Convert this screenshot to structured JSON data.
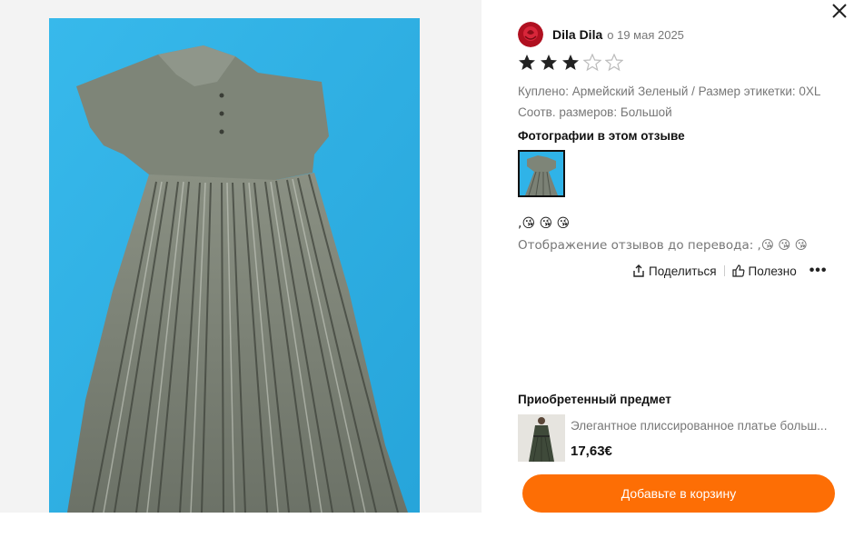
{
  "review": {
    "author": "Dila Dila",
    "date": "о 19 мая 2025",
    "rating": 3,
    "max_rating": 5,
    "purchased": "Куплено: Армейский Зеленый / Размер этикетки: 0XL",
    "fit": "Соотв. размеров: Большой",
    "photos_title": "Фотографии в этом отзыве",
    "text": ",😘 😘 😘",
    "translation_note": "Отображение отзывов до перевода: ,😘 😘 😘"
  },
  "actions": {
    "share_label": "Поделиться",
    "helpful_label": "Полезно",
    "more_label": "•••"
  },
  "product": {
    "section_title": "Приобретенный предмет",
    "name": "Элегантное плиссированное платье больш...",
    "price": "17,63€"
  },
  "cart_button_label": "Добавьте в корзину",
  "colors": {
    "accent": "#fd6e05",
    "star": "#222222",
    "star_empty": "#bbbbbb",
    "dress": "#7e8578",
    "bedsheet": "#2fb3e8"
  },
  "icons": {
    "close": "close-icon",
    "share": "share-icon",
    "helpful": "thumbs-up-icon",
    "more": "more-dots-icon"
  }
}
